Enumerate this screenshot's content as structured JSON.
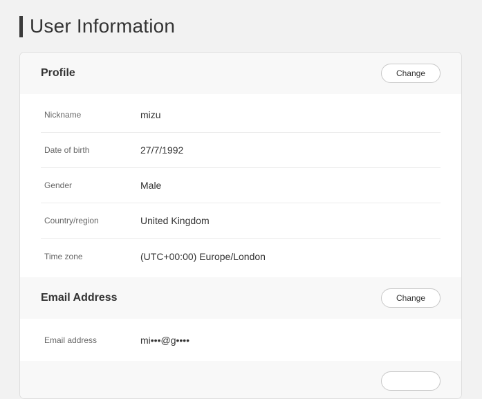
{
  "page": {
    "title": "User Information"
  },
  "profile": {
    "title": "Profile",
    "change_label": "Change",
    "rows": [
      {
        "label": "Nickname",
        "value": "mizu"
      },
      {
        "label": "Date of birth",
        "value": "27/7/1992"
      },
      {
        "label": "Gender",
        "value": "Male"
      },
      {
        "label": "Country/region",
        "value": "United Kingdom"
      },
      {
        "label": "Time zone",
        "value": "(UTC+00:00) Europe/London"
      }
    ]
  },
  "email": {
    "title": "Email Address",
    "change_label": "Change",
    "rows": [
      {
        "label": "Email address",
        "value": "mi•••@g••••"
      }
    ]
  }
}
